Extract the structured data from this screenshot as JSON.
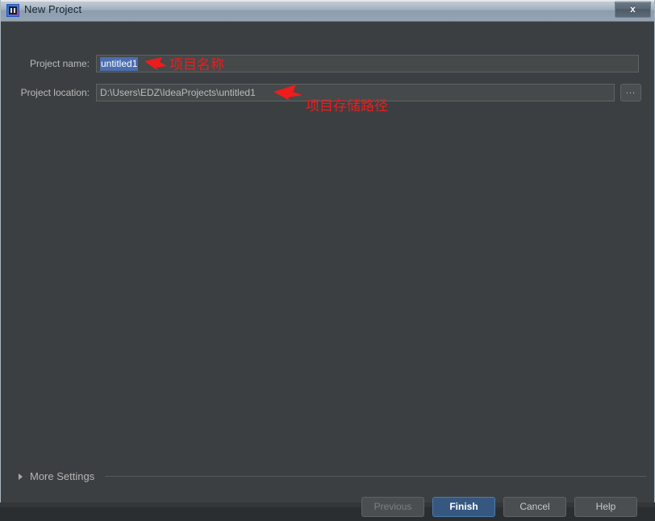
{
  "background_window": {
    "menu_items_blurred": [
      "",
      "",
      "",
      "",
      "",
      ""
    ]
  },
  "titlebar": {
    "title": "New Project",
    "app_icon": "intellij-idea-icon",
    "close_label": "x"
  },
  "form": {
    "project_name": {
      "label": "Project name:",
      "value": "untitled1",
      "selected": true
    },
    "project_location": {
      "label": "Project location:",
      "value": "D:\\Users\\EDZ\\IdeaProjects\\untitled1"
    },
    "browse_label": "..."
  },
  "annotations": [
    {
      "text": "项目名称",
      "color": "#ee1c1c"
    },
    {
      "text": "项目存储路径",
      "color": "#ee1c1c"
    }
  ],
  "more_settings": {
    "label": "More Settings",
    "expanded": false
  },
  "buttons": {
    "previous": "Previous",
    "finish": "Finish",
    "cancel": "Cancel",
    "help": "Help"
  },
  "colors": {
    "dialog_bg": "#3c3f41",
    "field_bg": "#45494a",
    "selection_blue": "#4b6eaf",
    "default_button_blue": "#365880",
    "annotation_red": "#ee1c1c"
  }
}
